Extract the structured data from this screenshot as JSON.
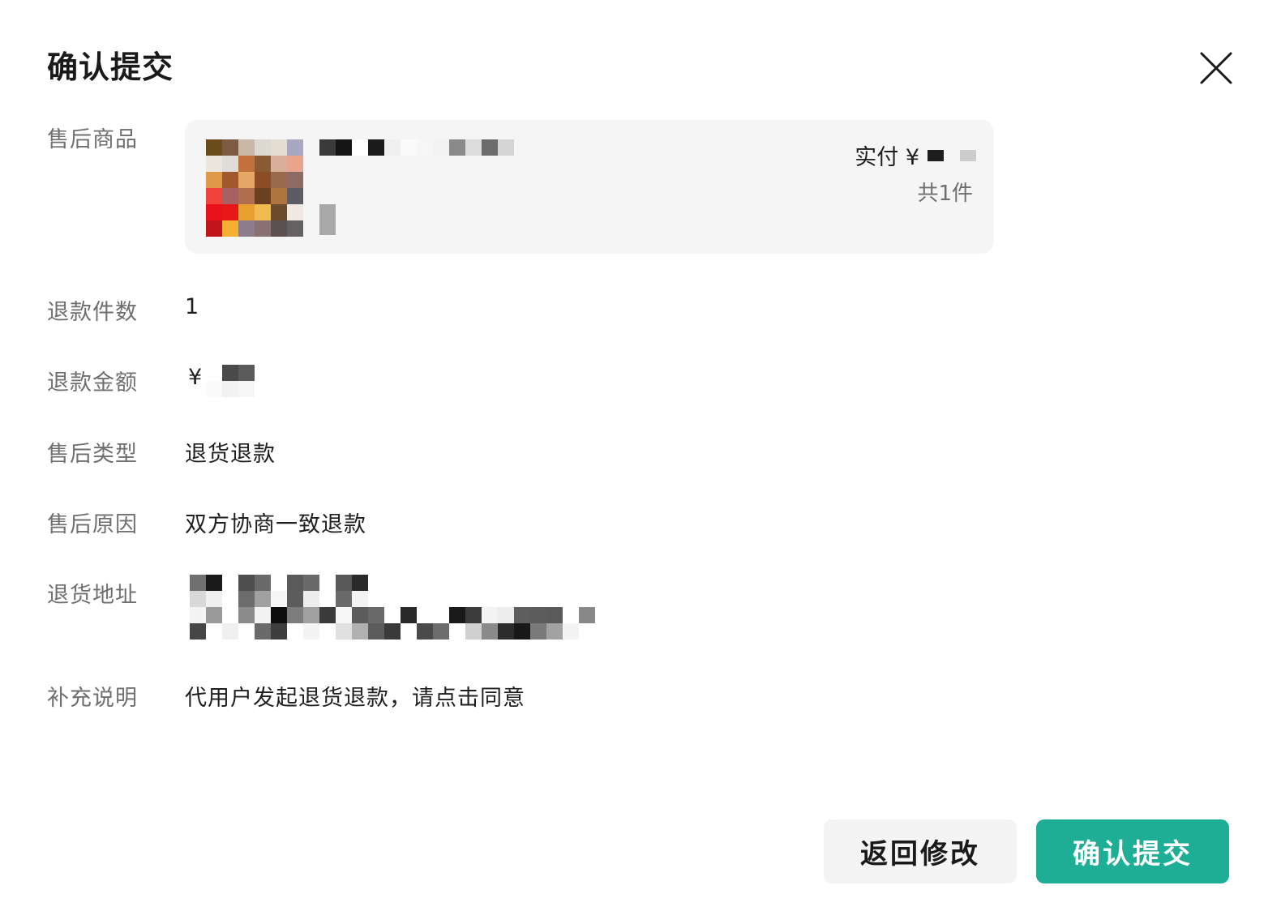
{
  "dialog": {
    "title": "确认提交"
  },
  "fields": {
    "product": {
      "label": "售后商品"
    },
    "refund_qty": {
      "label": "退款件数",
      "value": "1"
    },
    "refund_amount": {
      "label": "退款金额",
      "currency": "¥"
    },
    "after_sale_type": {
      "label": "售后类型",
      "value": "退货退款"
    },
    "after_sale_reason": {
      "label": "售后原因",
      "value": "双方协商一致退款"
    },
    "return_address": {
      "label": "退货地址"
    },
    "note": {
      "label": "补充说明",
      "value": "代用户发起退货退款，请点击同意"
    }
  },
  "product_card": {
    "paid_label": "实付 ¥",
    "count_text": "共1件"
  },
  "buttons": {
    "back_label": "返回修改",
    "confirm_label": "确认提交"
  },
  "colors": {
    "accent": "#1eae95",
    "card_bg": "#f5f5f5",
    "label_gray": "#6f6f6f"
  },
  "icons": {
    "close": "close-icon"
  }
}
